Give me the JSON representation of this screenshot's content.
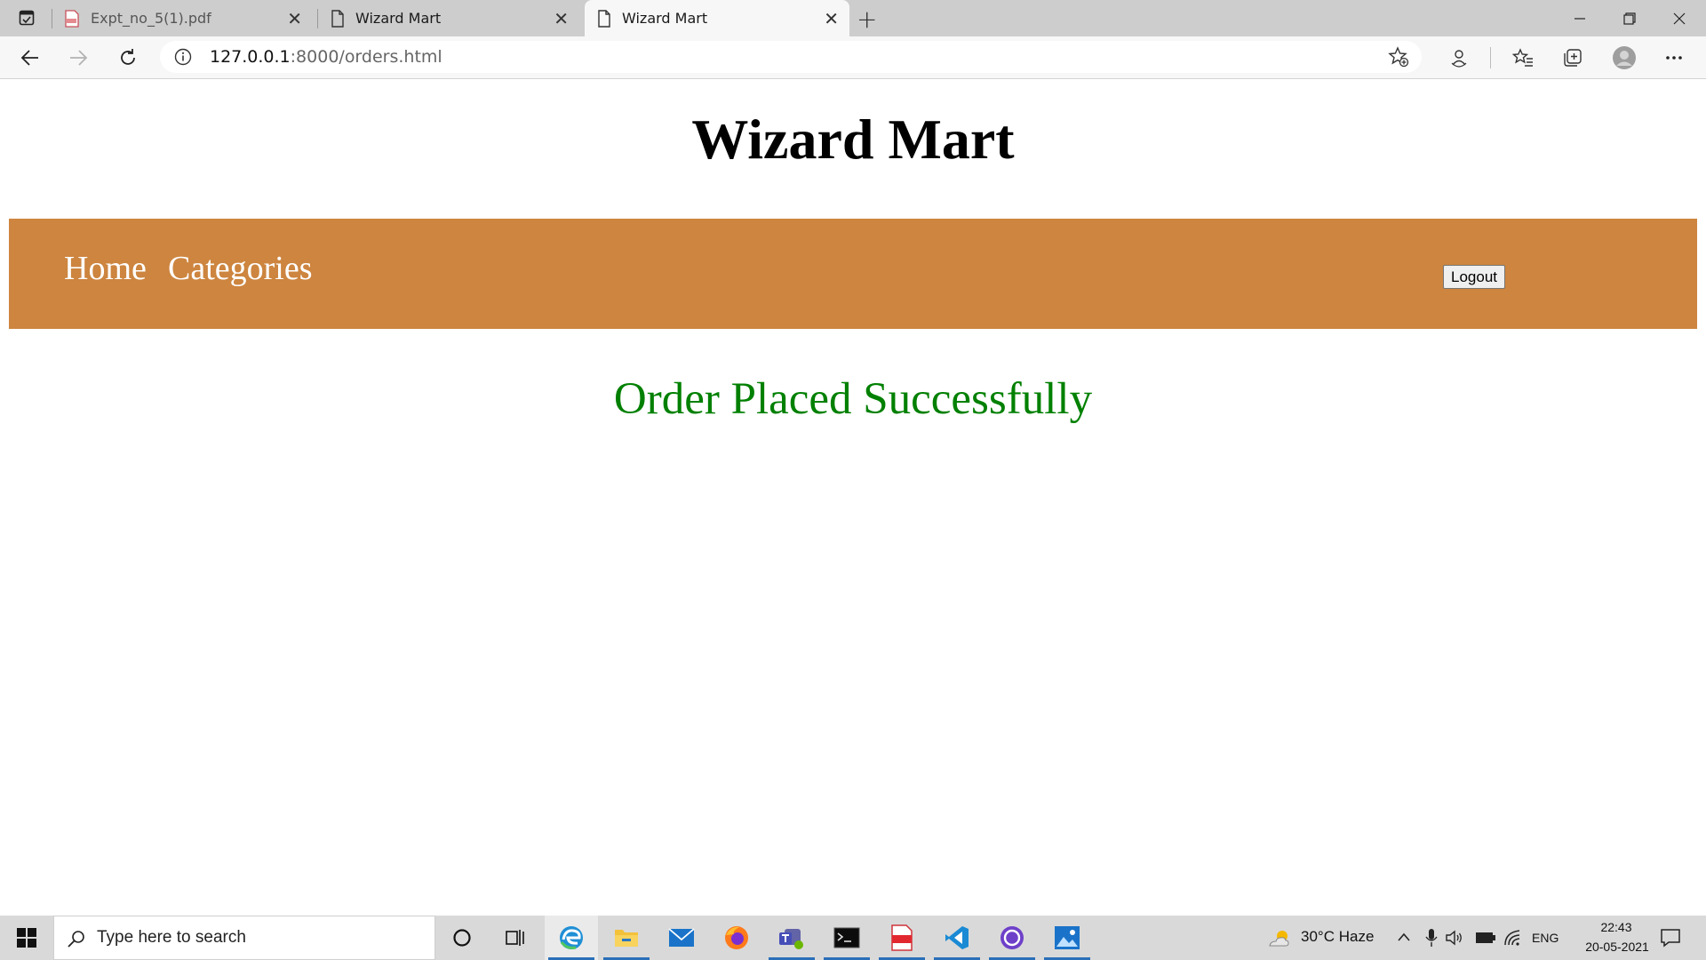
{
  "browser": {
    "tabs": [
      {
        "title": "Expt_no_5(1).pdf",
        "icon": "pdf-icon",
        "active": false
      },
      {
        "title": "Wizard Mart",
        "icon": "page-icon",
        "active": false
      },
      {
        "title": "Wizard Mart",
        "icon": "page-icon",
        "active": true
      }
    ],
    "url_host": "127.0.0.1",
    "url_rest": ":8000/orders.html"
  },
  "page": {
    "title": "Wizard Mart",
    "nav": {
      "home": "Home",
      "categories": "Categories",
      "logout": "Logout"
    },
    "message": "Order Placed Successfully"
  },
  "colors": {
    "navbar_bg": "#cd853f",
    "success_text": "#008000"
  },
  "taskbar": {
    "search_placeholder": "Type here to search",
    "weather": "30°C  Haze",
    "language": "ENG",
    "time": "22:43",
    "date": "20-05-2021"
  }
}
